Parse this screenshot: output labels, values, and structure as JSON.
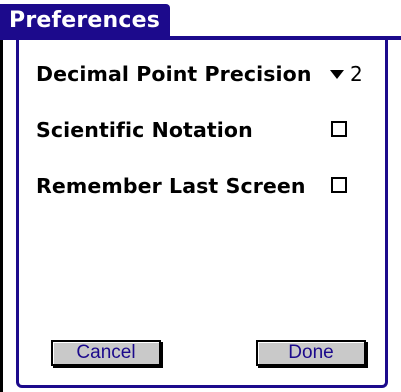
{
  "dialog": {
    "title": "Preferences"
  },
  "settings": {
    "decimal_label": "Decimal Point Precision",
    "decimal_value": "2",
    "scientific_label": "Scientific Notation",
    "scientific_checked": false,
    "remember_label": "Remember Last Screen",
    "remember_checked": false
  },
  "buttons": {
    "cancel_label": "Cancel",
    "done_label": "Done"
  },
  "icons": {
    "picker": "dropdown-triangle-icon",
    "checkbox": "checkbox-unchecked-icon"
  },
  "colors": {
    "accent": "#1c0a8c",
    "button_face": "#c9c9c9"
  }
}
